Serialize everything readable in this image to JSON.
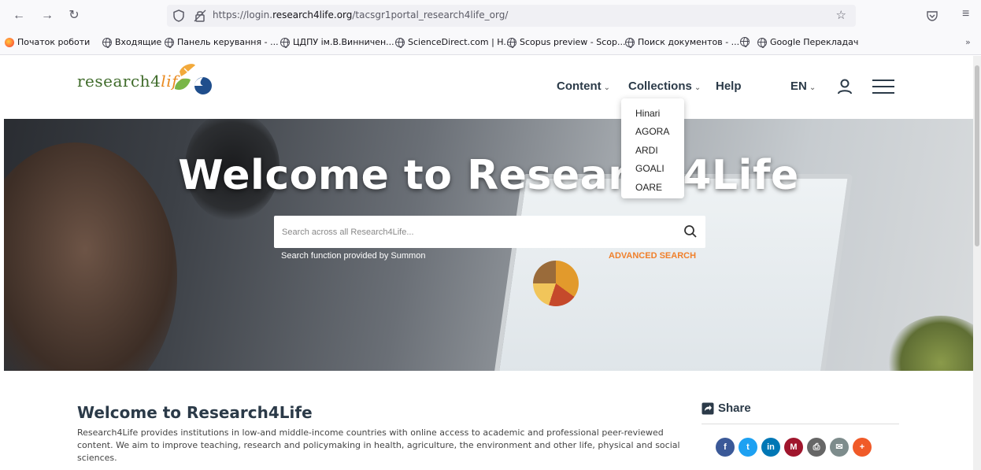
{
  "browser": {
    "url_prefix": "https://login.",
    "url_domain": "research4life.org",
    "url_path": "/tacsgr1portal_research4life_org/",
    "bookmarks": [
      "Початок роботи",
      "Входящие",
      "Панель керування - ...",
      "ЦДПУ ім.В.Винничен...",
      "ScienceDirect.com | H...",
      "Scopus preview - Scop...",
      "Поиск документов - ...",
      "",
      "Google Перекладач"
    ]
  },
  "header": {
    "logo_main": "research4",
    "logo_accent": "life",
    "nav": {
      "content": "Content",
      "collections": "Collections",
      "help": "Help",
      "language": "EN"
    },
    "collections_menu": [
      "Hinari",
      "AGORA",
      "ARDI",
      "GOALI",
      "OARE"
    ]
  },
  "hero": {
    "title": "Welcome to Research4Life",
    "search_placeholder": "Search across all Research4Life...",
    "search_note": "Search function provided by Summon",
    "advanced_search": "ADVANCED SEARCH"
  },
  "main": {
    "title": "Welcome to Research4Life",
    "text": "Research4Life provides institutions in low-and middle-income countries with online access to academic and professional peer-reviewed content. We aim to improve teaching, research and policymaking in health, agriculture, the environment and other life, physical and social sciences."
  },
  "share": {
    "title": "Share",
    "buttons": [
      {
        "name": "facebook",
        "glyph": "f",
        "color": "#3b5998"
      },
      {
        "name": "twitter",
        "glyph": "t",
        "color": "#1da1f2"
      },
      {
        "name": "linkedin",
        "glyph": "in",
        "color": "#0077b5"
      },
      {
        "name": "mendeley",
        "glyph": "M",
        "color": "#a0162d"
      },
      {
        "name": "print",
        "glyph": "⎙",
        "color": "#666666"
      },
      {
        "name": "email",
        "glyph": "✉",
        "color": "#7d8c8c"
      },
      {
        "name": "more",
        "glyph": "+",
        "color": "#f05a28"
      }
    ]
  }
}
